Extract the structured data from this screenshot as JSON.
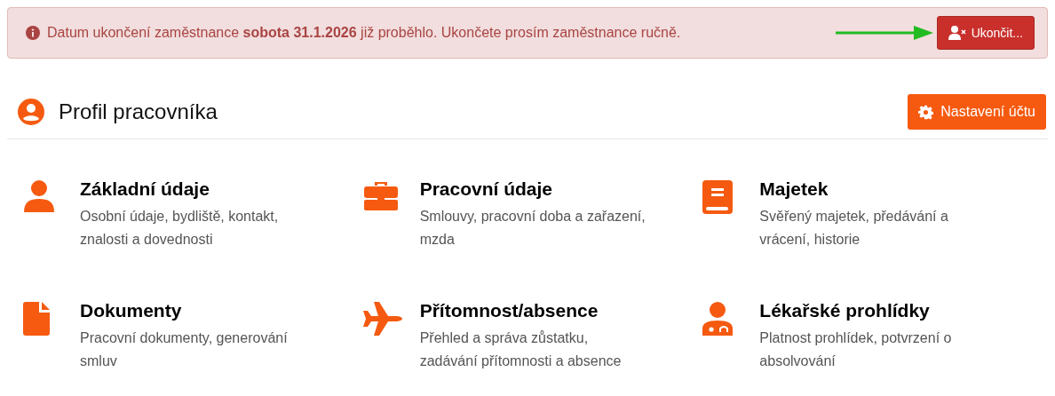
{
  "alert": {
    "message": "Datum ukončení zaměstnance **sobota 31.1.2026** již proběhlo. Ukončete prosím zaměstnance ručně.",
    "button": "Ukončit..."
  },
  "header": {
    "title": "Profil pracovníka",
    "button": "Nastavení účtu"
  },
  "cards": [
    {
      "title": "Základní údaje",
      "description": "Osobní údaje, bydliště, kontakt, znalosti a dovednosti"
    },
    {
      "title": "Pracovní údaje",
      "description": "Smlouvy, pracovní doba a zařazení, mzda"
    },
    {
      "title": "Majetek",
      "description": "Svěřený majetek, předávání a vrácení, historie"
    },
    {
      "title": "Dokumenty",
      "description": "Pracovní dokumenty, generování smluv"
    },
    {
      "title": "Přítomnost/absence",
      "description": "Přehled a správa zůstatku, zadávání přítomnosti a absence"
    },
    {
      "title": "Lékařské prohlídky",
      "description": "Platnost prohlídek, potvrzení o absolvování"
    }
  ]
}
